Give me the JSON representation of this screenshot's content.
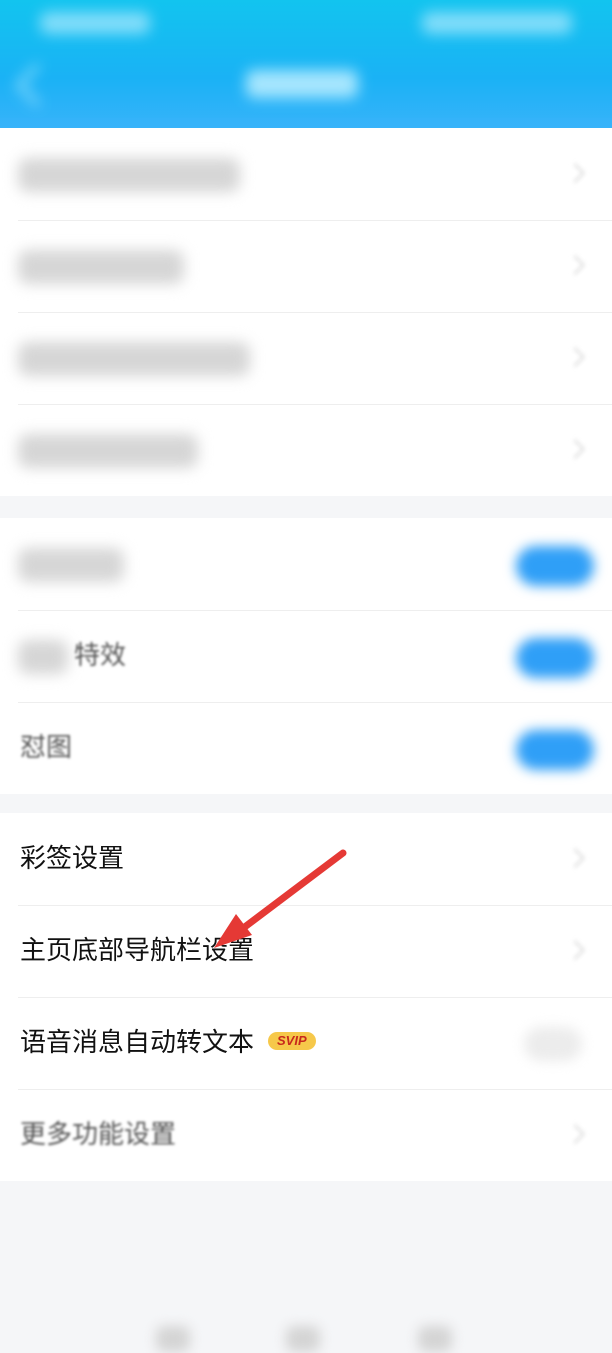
{
  "header": {
    "title": "",
    "back_icon": "back-arrow-icon"
  },
  "group1": {
    "items": [
      {
        "label": "",
        "icon": "chevron-right-icon"
      },
      {
        "label": "",
        "icon": "chevron-right-icon"
      },
      {
        "label": "",
        "icon": "chevron-right-icon"
      },
      {
        "label": "",
        "icon": "chevron-right-icon"
      }
    ]
  },
  "group2": {
    "items": [
      {
        "label": "",
        "toggle": "on"
      },
      {
        "label": "特效",
        "toggle": "on"
      },
      {
        "label": "怼图",
        "toggle": "on"
      }
    ]
  },
  "group3": {
    "items": [
      {
        "label": "彩签设置",
        "icon": "chevron-right-icon"
      },
      {
        "label": "主页底部导航栏设置",
        "icon": "chevron-right-icon"
      },
      {
        "label": "语音消息自动转文本",
        "badge": "SVIP",
        "toggle": "off"
      },
      {
        "label": "更多功能设置",
        "icon": "chevron-right-icon"
      }
    ]
  },
  "annotation": {
    "color": "#e53935",
    "icon": "red-arrow-icon"
  },
  "colors": {
    "header": "#1ab2f5",
    "toggle_on": "#2f9ff7",
    "badge_bg": "#f6c84a",
    "badge_text": "#c8291c"
  }
}
